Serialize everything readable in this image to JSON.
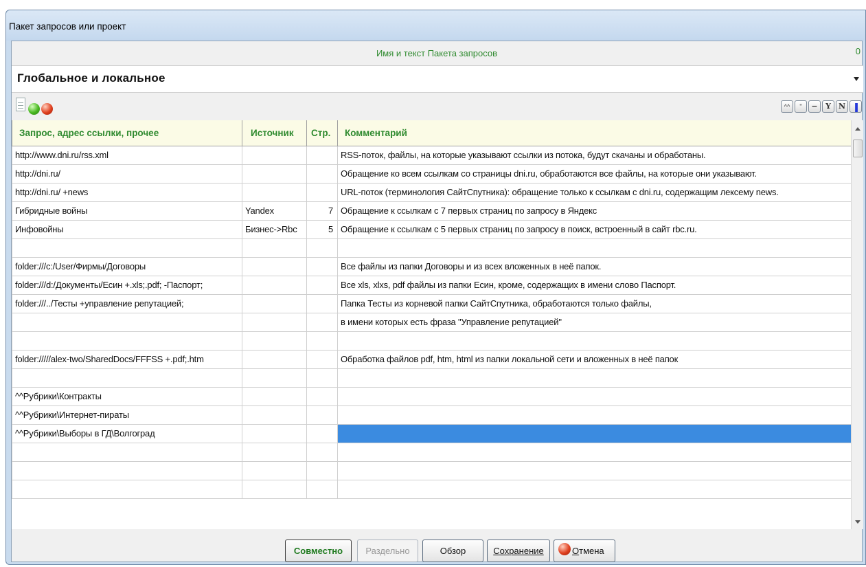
{
  "window": {
    "title": "Пакет запросов или проект"
  },
  "package": {
    "header": "Имя и текст Пакета запросов",
    "counter": "0",
    "name": "Глобальное и локальное"
  },
  "toolbar": {
    "buttons": [
      "^^",
      "\"",
      "−",
      "Y",
      "N",
      "||"
    ]
  },
  "table": {
    "columns": [
      "Запрос, адрес ссылки, прочее",
      "Источник",
      "Стр.",
      "Комментарий"
    ],
    "rows": [
      [
        "http://www.dni.ru/rss.xml",
        "",
        "",
        "RSS-поток, файлы, на которые указывают ссылки из потока, будут скачаны и обработаны."
      ],
      [
        "http://dni.ru/",
        "",
        "",
        "Обращение ко всем ссылкам со страницы dni.ru, обработаются все файлы, на которые они указывают."
      ],
      [
        "http://dni.ru/ +news",
        "",
        "",
        "URL-поток (терминология СайтСпутника): обращение только к ссылкам с dni.ru, содержащим  лексему news."
      ],
      [
        "Гибридные войны",
        "Yandex",
        "7",
        "Обращение к ссылкам с 7 первых страниц по запросу в Яндекс"
      ],
      [
        "Инфовойны",
        "Бизнес->Rbc",
        "5",
        "Обращение к ссылкам с 5 первых страниц по запросу в поиск, встроенный в сайт rbc.ru."
      ],
      [
        "",
        "",
        "",
        ""
      ],
      [
        "folder:///c:/User/Фирмы/Договоры",
        "",
        "",
        "Все файлы из папки Договоры и из всех вложенных в неё папок."
      ],
      [
        "folder:///d:/Документы/Есин +.xls;.pdf; -Паспорт;",
        "",
        "",
        "Все xls, xlxs, pdf файлы из папки Есин, кроме, содержащих в имени слово Паспорт."
      ],
      [
        "folder:///../Тесты +управление репутацией;",
        "",
        "",
        "Папка Тесты из корневой папки СайтСпутника,  обработаются только файлы,"
      ],
      [
        "",
        "",
        "",
        "в имени которых есть фраза \"Управление репутацией\""
      ],
      [
        "",
        "",
        "",
        ""
      ],
      [
        "folder://///alex-two/SharedDocs/FFFSS +.pdf;.htm",
        "",
        "",
        "Обработка файлов pdf, htm, html из папки локальной сети и вложенных в неё папок"
      ],
      [
        "",
        "",
        "",
        ""
      ],
      [
        "^^Рубрики\\Контракты",
        "",
        "",
        ""
      ],
      [
        "^^Рубрики\\Интернет-пираты",
        "",
        "",
        ""
      ],
      [
        "^^Рубрики\\Выборы в ГД\\Волгоград",
        "",
        "",
        ""
      ],
      [
        "",
        "",
        "",
        ""
      ],
      [
        "",
        "",
        "",
        ""
      ],
      [
        "",
        "",
        "",
        ""
      ]
    ],
    "selected_row": 15,
    "selected_col": 3
  },
  "buttons": {
    "together": "Совместно",
    "separately": "Раздельно",
    "browse": "Обзор",
    "save": "Сохранение",
    "cancel_first": "О",
    "cancel_rest": "тмена"
  },
  "colors": {
    "header_green": "#2f8a2f",
    "selection_blue": "#3b8be0",
    "header_bg": "#fbfbe6"
  }
}
